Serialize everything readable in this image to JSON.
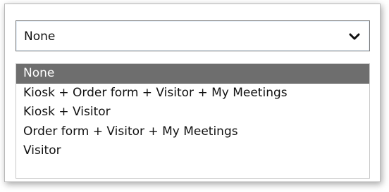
{
  "select": {
    "value": "None",
    "chevron_icon": "chevron-down-icon"
  },
  "options": [
    "None",
    "Kiosk + Order form + Visitor + My Meetings",
    "Kiosk + Visitor",
    "Order form + Visitor + My Meetings",
    "Visitor"
  ],
  "selected_index": 0,
  "colors": {
    "highlight_bg": "#6e6e6e",
    "highlight_text": "#ffffff",
    "border": "#7a7a7a"
  }
}
